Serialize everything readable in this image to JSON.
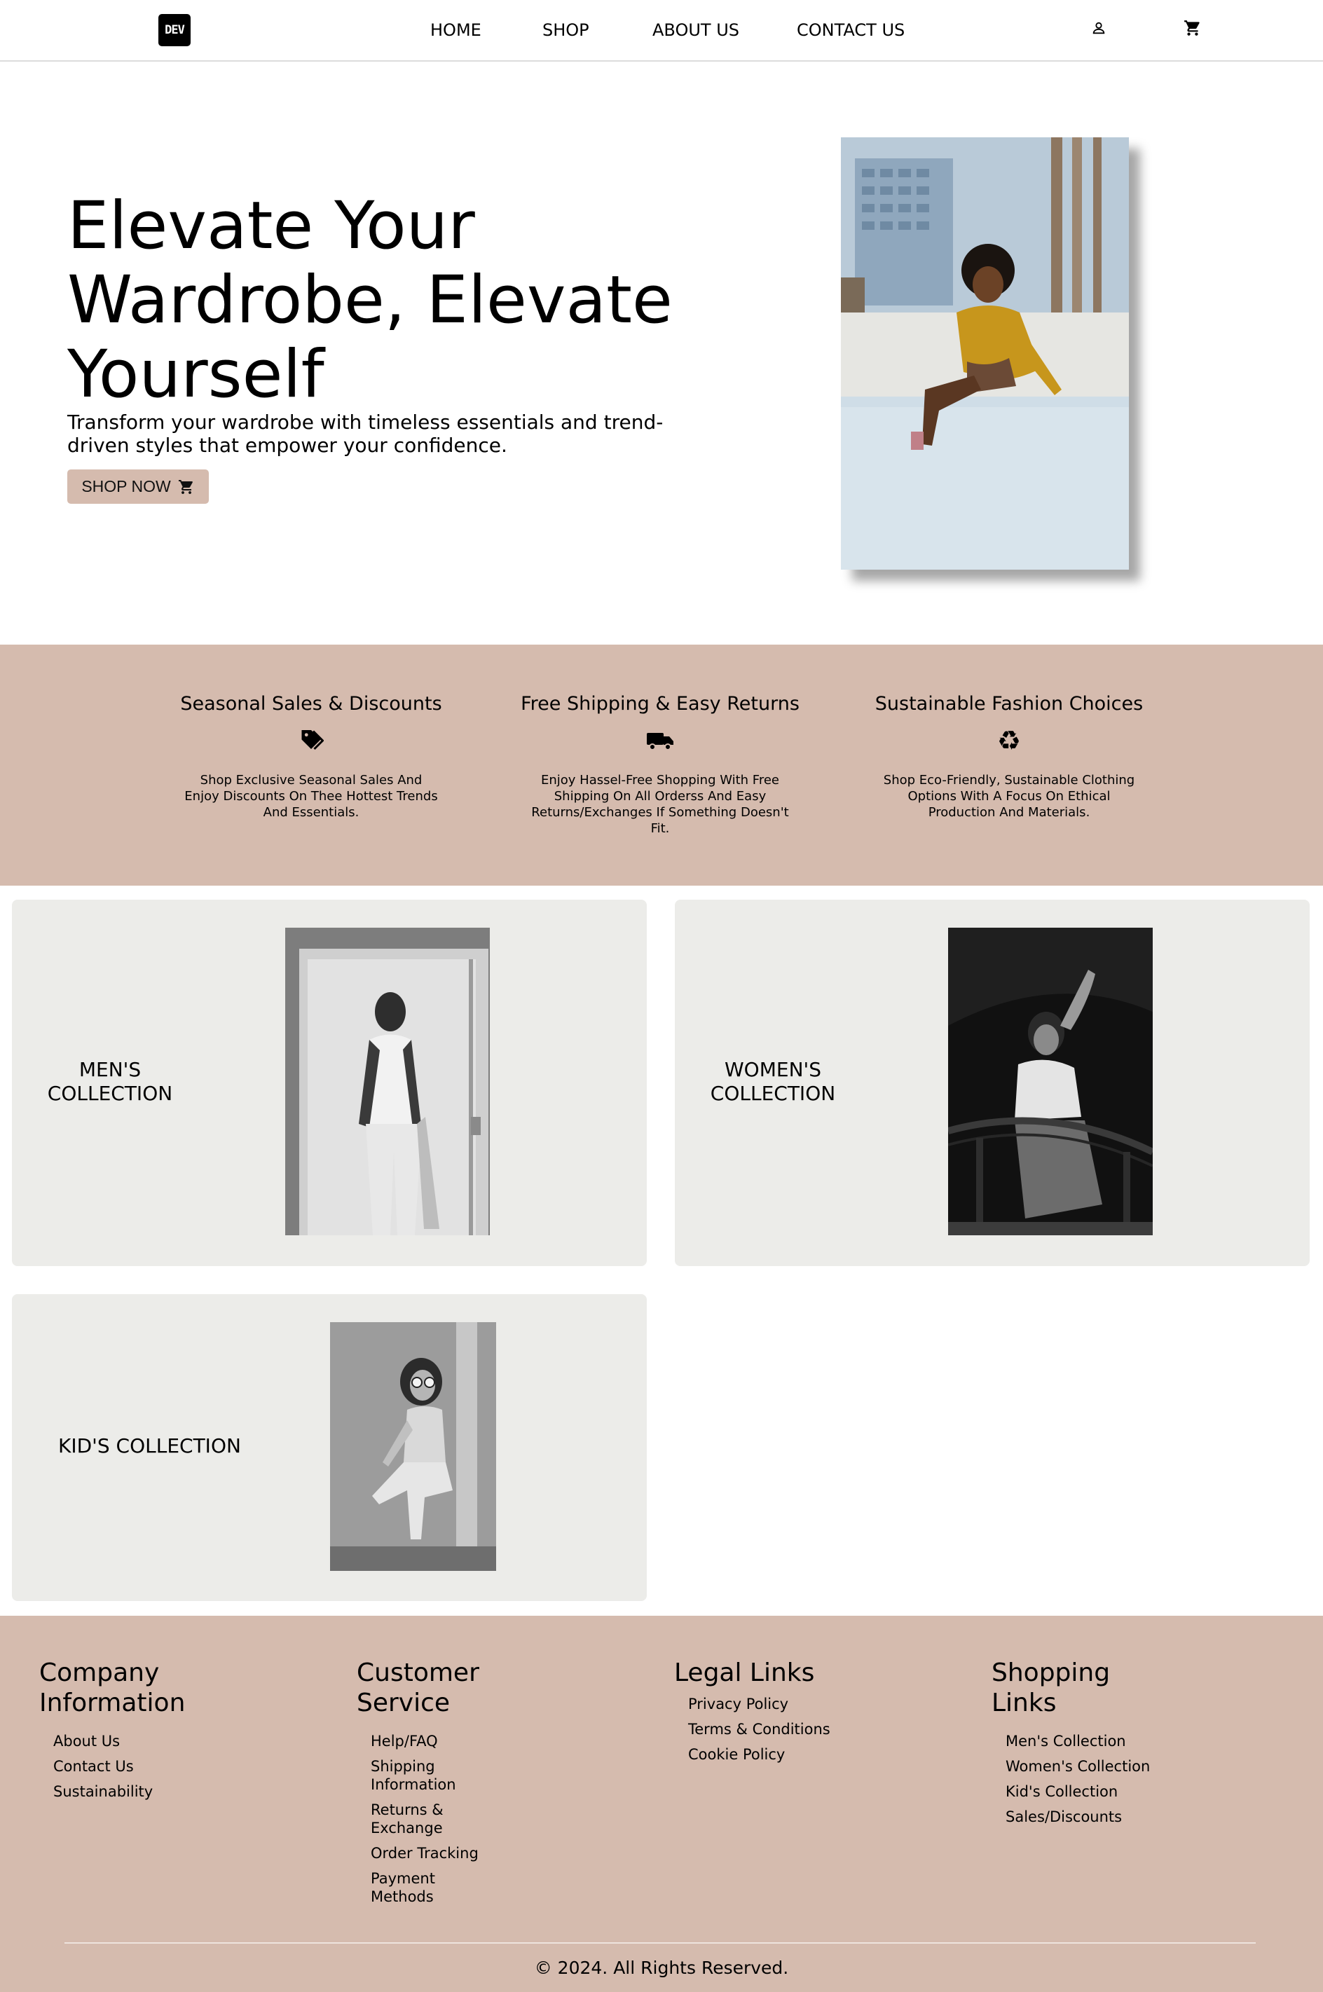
{
  "nav": {
    "logo_text": "DEV",
    "links": [
      "HOME",
      "SHOP",
      "ABOUT US",
      "CONTACT US"
    ],
    "icons": [
      "user-icon",
      "cart-icon"
    ]
  },
  "hero": {
    "title": "Elevate Your Wardrobe, Elevate Yourself",
    "subtitle": "Transform your wardrobe with timeless essentials and trend-driven styles that empower your confidence.",
    "cta_label": "SHOP NOW",
    "cta_icon": "cart-icon",
    "image_subject": "woman-sitting-outdoors-photo"
  },
  "features": [
    {
      "title": "Seasonal Sales & Discounts",
      "icon": "tag-icon",
      "text": "Shop Exclusive Seasonal Sales And Enjoy Discounts On Thee Hottest Trends And Essentials."
    },
    {
      "title": "Free Shipping & Easy Returns",
      "icon": "truck-icon",
      "text": "Enjoy Hassel-Free Shopping With Free Shipping On All Orderss And Easy Returns/Exchanges If Something Doesn't Fit."
    },
    {
      "title": "Sustainable Fashion Choices",
      "icon": "recycle-icon",
      "text": "Shop Eco-Friendly, Sustainable Clothing Options With A Focus On Ethical Production And Materials."
    }
  ],
  "collections": [
    {
      "label": "MEN'S COLLECTION"
    },
    {
      "label": "WOMEN'S COLLECTION"
    },
    {
      "label": "KID'S COLLECTION"
    }
  ],
  "footer": {
    "columns": [
      {
        "title": "Company Information",
        "links": [
          "About Us",
          "Contact Us",
          "Sustainability"
        ]
      },
      {
        "title": "Customer Service",
        "links": [
          "Help/FAQ",
          "Shipping Information",
          "Returns & Exchange",
          "Order Tracking",
          "Payment Methods"
        ]
      },
      {
        "title": "Legal Links",
        "links": [
          "Privacy Policy",
          "Terms & Conditions",
          "Cookie Policy"
        ]
      },
      {
        "title": "Shopping Links",
        "links": [
          "Men's Collection",
          "Women's Collection",
          "Kid's Collection",
          "Sales/Discounts"
        ]
      }
    ],
    "copyright": "© 2024. All Rights Reserved."
  },
  "colors": {
    "accent": "#d5bbae",
    "card_bg": "#ecece9"
  }
}
